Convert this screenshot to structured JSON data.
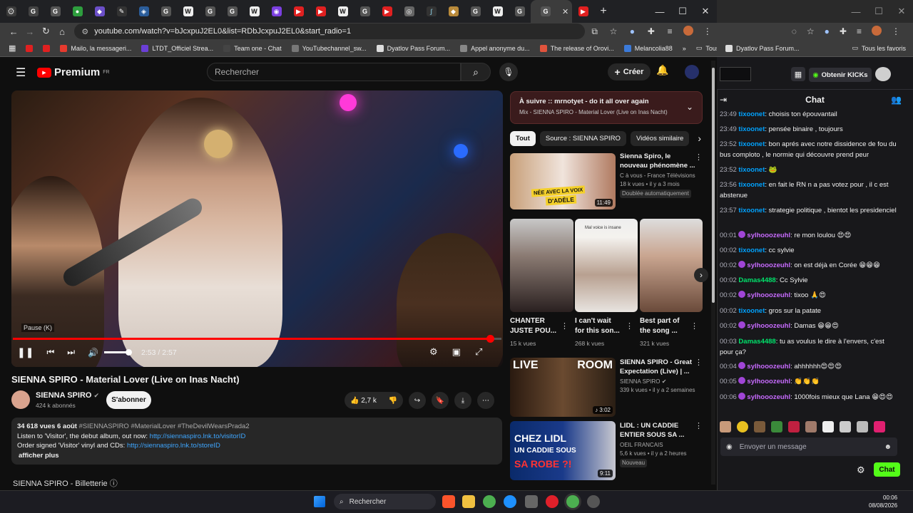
{
  "browser": {
    "url": "youtube.com/watch?v=bJcxpuJ2EL0&list=RDbJcxpuJ2EL0&start_radio=1",
    "new_tab": "+",
    "tab_close": "✕",
    "window_min": "—",
    "window_max": "☐",
    "window_close": "✕",
    "bookmarks": [
      {
        "label": "Mailo, la messageri...",
        "color": "#e63a2e"
      },
      {
        "label": "LTDT_Officiel Strea...",
        "color": "#6b3fd6"
      },
      {
        "label": "Team one - Chat",
        "color": "#444"
      },
      {
        "label": "YouTubechannel_sw...",
        "color": "#777"
      },
      {
        "label": "Dyatlov Pass Forum...",
        "color": "#ddd"
      },
      {
        "label": "Appel anonyme du...",
        "color": "#888"
      },
      {
        "label": "The release of Orovi...",
        "color": "#e0533c"
      },
      {
        "label": "Melancolia88",
        "color": "#3b7ad9"
      }
    ],
    "bookmarks_more": "»",
    "all_bookmarks": "Tous les favoris",
    "second_window": {
      "bookmark": "Dyatlov Pass Forum...",
      "all_bookmarks": "Tous les favoris"
    }
  },
  "youtube": {
    "logo": "Premium",
    "logo_region": "FR",
    "search_placeholder": "Rechercher",
    "create": "Créer",
    "player": {
      "pause_hint": "Pause (K)",
      "time": "2:53 / 2:57",
      "progress": 0.977
    },
    "title": "SIENNA SPIRO - Material Lover (Live on Inas Nacht)",
    "channel": "SIENNA SPIRO",
    "subscribers": "424 k abonnés",
    "subscribe": "S'abonner",
    "likes": "2,7 k",
    "description": {
      "stats": "34 618 vues  6 août",
      "tags": "#SIENNASPIRO #MaterialLover #TheDevilWearsPrada2",
      "line1": "Listen to 'Visitor', the debut album, out now:",
      "link1": "http://siennaspiro.lnk.to/visitorID",
      "line2": "Order signed 'Visitor' vinyl and CDs:",
      "link2": "http://siennaspiro.lnk.to/storeID",
      "more": "afficher plus"
    },
    "billetterie": "SIENNA SPIRO - Billetterie",
    "queue": {
      "title": "À suivre :: mrnotyet - do it all over again",
      "subtitle": "Mix - SIENNA SPIRO - Material Lover (Live on Inas Nacht)"
    },
    "chips": [
      "Tout",
      "Source : SIENNA SPIRO",
      "Vidéos similaire"
    ],
    "recs": [
      {
        "title1": "Sienna Spiro, le",
        "title2": "nouveau phénomène ...",
        "channel": "C à vous - France Télévisions",
        "meta": "18 k vues • il y a 3 mois",
        "extra": "Doublée automatiquement",
        "duration": "11:49",
        "thumb_text1": "NÉE AVEC LA VOIX",
        "thumb_text2": "D'ADÈLE"
      },
      {
        "title1": "SIENNA SPIRO - Great",
        "title2": "Expectation (Live) | ...",
        "channel": "SIENNA SPIRO",
        "meta": "339 k vues • il y a 2 semaines",
        "duration": "3:02",
        "thumb_text1": "LIVE",
        "thumb_text2": "ROOM"
      },
      {
        "title1": "LIDL : UN CADDIE",
        "title2": "ENTIER SOUS SA ...",
        "channel": "OEIL FRANCAIS",
        "meta": "5,6 k vues • il y a 2 heures",
        "extra": "Nouveau",
        "duration": "9:11",
        "thumb_text1": "CHEZ LIDL",
        "thumb_text2": "UN CADDIE SOUS",
        "thumb_text3": "SA ROBE ?!"
      }
    ],
    "shorts": [
      {
        "title1": "CHANTER",
        "title2": "JUSTE POU...",
        "views": "15 k vues"
      },
      {
        "title1": "I can't wait",
        "title2": "for this son...",
        "views": "268 k vues",
        "caption": "Mal voice is insane"
      },
      {
        "title1": "Best part of",
        "title2": "the song ...",
        "views": "321 k vues"
      }
    ]
  },
  "chat": {
    "header": "Chat",
    "kick_button": "Obtenir KICKs",
    "input_placeholder": "Envoyer un message",
    "send": "Chat",
    "messages": [
      {
        "time": "23:49",
        "user": "tixoonet",
        "text": ": choisis ton épouvantail",
        "cls": "u1"
      },
      {
        "time": "23:49",
        "user": "tixoonet",
        "text": ": pensée binaire , toujours",
        "cls": "u1"
      },
      {
        "time": "23:52",
        "user": "tixoonet",
        "text": ": bon aprés avec notre dissidence de fou du bus complotо , le normie qui découvre prend peur",
        "cls": "u1"
      },
      {
        "time": "23:52",
        "user": "tixoonet",
        "text": ": 🐸",
        "cls": "u1"
      },
      {
        "time": "23:56",
        "user": "tixoonet",
        "text": ": en fait le RN n a pas votez pour , il c est abstenue",
        "cls": "u1"
      },
      {
        "time": "23:57",
        "user": "tixoonet",
        "text": ": strategie politique , bientot les presidenciel",
        "cls": "u1"
      },
      {
        "time": "00:01",
        "user": "sylhooozeuhl",
        "text": ": re mon loulou 😍😍",
        "cls": "u2",
        "badge": true
      },
      {
        "time": "00:02",
        "user": "tixoonet",
        "text": ": cc sylvie",
        "cls": "u1"
      },
      {
        "time": "00:02",
        "user": "sylhooozeuhl",
        "text": ": on est déjà en Corée 😁😁😁",
        "cls": "u2",
        "badge": true
      },
      {
        "time": "00:02",
        "user": "Damas4488",
        "text": ": Cc Sylvie",
        "cls": "u3"
      },
      {
        "time": "00:02",
        "user": "sylhooozeuhl",
        "text": ": tixoo 🙏😍",
        "cls": "u2",
        "badge": true
      },
      {
        "time": "00:02",
        "user": "tixoonet",
        "text": ": gros sur la patate",
        "cls": "u1"
      },
      {
        "time": "00:02",
        "user": "sylhooozeuhl",
        "text": ": Damas 😁😁😍",
        "cls": "u2",
        "badge": true
      },
      {
        "time": "00:03",
        "user": "Damas4488",
        "text": ": tu as voulus le dire à l'envers, c'est pour ça?",
        "cls": "u3"
      },
      {
        "time": "00:04",
        "user": "sylhooozeuhl",
        "text": ": ahhhhhh😍😍😍",
        "cls": "u2",
        "badge": true
      },
      {
        "time": "00:05",
        "user": "sylhooozeuhl",
        "text": ": 👏👏👏",
        "cls": "u2",
        "badge": true
      },
      {
        "time": "00:06",
        "user": "sylhooozeuhl",
        "text": ": 1000fois mieux que Lana 😁😍😍",
        "cls": "u2",
        "badge": true
      }
    ]
  },
  "taskbar": {
    "search": "Rechercher",
    "time": "00:06",
    "date": "08/08/2026"
  }
}
